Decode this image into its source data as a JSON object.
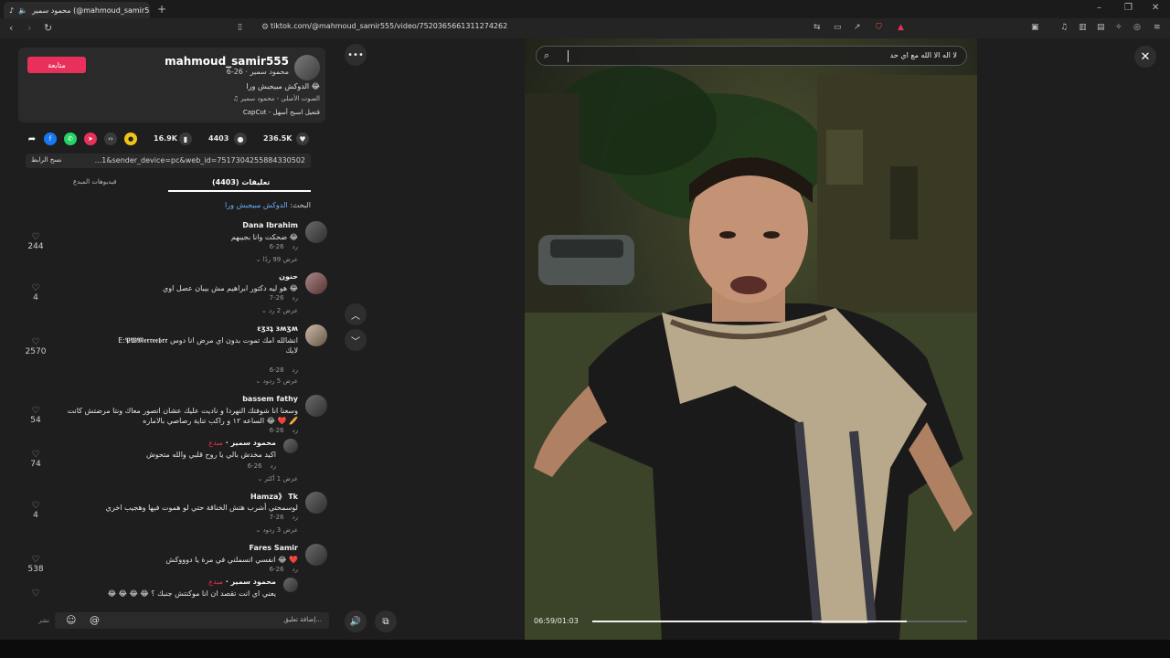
{
  "browser": {
    "tab_title": "محمود سمير (@mahmoud_samir555",
    "url_host": "tiktok.com",
    "url_path": "/@mahmoud_samir555/video/7520365661311274262"
  },
  "profile": {
    "follow_label": "متابعة",
    "username": "mahmoud_samir555",
    "display_name": "محمود سمير · 26-6",
    "caption": "الدوكش مبيجبش ورا 😂",
    "sound": "♫ الصوت الأصلي - محمود سمير",
    "capcut": "CapCut - قتعيل اسبح أسهل"
  },
  "stats": {
    "likes": "236.5K",
    "comments": "4403",
    "saves": "16.9K"
  },
  "link": {
    "copy_label": "نسخ الرابط",
    "text": "...1&sender_device=pc&web_id=7517304255884330502"
  },
  "tabs": {
    "comments": "تعليقات (4403)",
    "creator_videos": "فيديوهات المبدع"
  },
  "search_hint": {
    "prefix": "البحث: ",
    "term": "الدوكش مبيجبش ورا"
  },
  "comments": [
    {
      "name": "Dana Ibrahim",
      "text": "ضحكت وانا بجيبهم 😂",
      "date": "26-6",
      "reply": "رد",
      "more": "عرض 99 ردًا",
      "likes": "244"
    },
    {
      "name": "حنون",
      "text": "هو ليه دكتور ابراهيم مش بيبان عصل اوي 😂",
      "date": "26-7",
      "reply": "رد",
      "more": "عرض 2 رد",
      "likes": "4"
    },
    {
      "name": "ɛʒɜʇ ɜʍʒʍ",
      "text": "E:𝕻𝖂𝕸𝖊𝖗𝖗𝖊𝖊𝖇𝖗𝖗 انشالله امك تموت بدون اي مرض انا دوس لايك",
      "date": "28-6",
      "reply": "رد",
      "more": "عرض 5 ردود",
      "likes": "2570"
    },
    {
      "name": "bassem fathy",
      "text": "وسعنا انا شوفتك النهردا و ناديت عليك عشان اتصور معاك ونتا مرضتش كانت الساعه ١٢ و راكب تناية رصاصي بالاماره 😂 ❤️ 🥖",
      "date": "26-6",
      "reply": "رد",
      "likes": "54"
    },
    {
      "name": "محمود سمير · ",
      "creator": "مبدع",
      "text": "اكيد مخدش بالي يا روح قلبي والله متحوش",
      "date": "26-6",
      "reply": "رد",
      "more": "عرض 1 أكثر",
      "likes": "74"
    },
    {
      "name": "Hamza》 Tk",
      "text": "لوسمحتي أشرب هتش الخناقة حتي لو هموت فيها وهجيب اخري",
      "date": "26-7",
      "reply": "رد",
      "more": "عرض 3 ردود",
      "likes": "4"
    },
    {
      "name": "Fares Samir",
      "text": "انفسي اتسملني في مرة يا دوووكش 😂 ❤️",
      "date": "26-6",
      "reply": "رد",
      "likes": "538"
    },
    {
      "name": "محمود سمير · ",
      "creator": "مبدع",
      "text": "😂 😂 😂 😂 يعني اي انت تقصد ان انا موكنتش جنبك ؟",
      "likes": ""
    }
  ],
  "composer": {
    "placeholder": "إضافة تعليق...",
    "post": "نشر"
  },
  "video": {
    "search_query": "لا اله الا الله مع اي حد",
    "time": "06:59/01:03",
    "progress": 0.84
  }
}
